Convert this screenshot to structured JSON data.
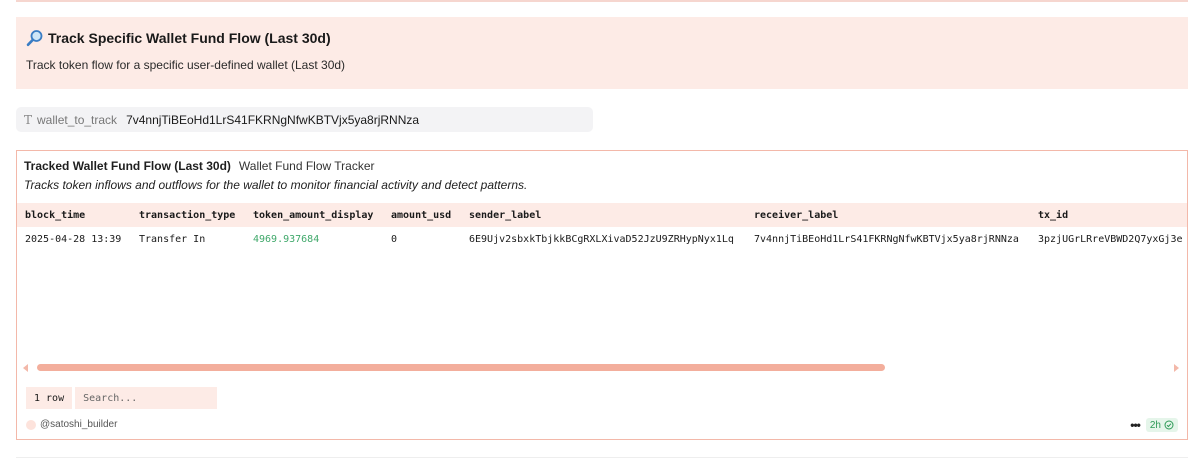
{
  "header": {
    "title": "Track Specific Wallet Fund Flow (Last 30d)",
    "subtitle": "Track token flow for a specific user-defined wallet (Last 30d)"
  },
  "parameter": {
    "name": "wallet_to_track",
    "value": "7v4nnjTiBEoHd1LrS41FKRNgNfwKBTVjx5ya8rjRNNza"
  },
  "panel": {
    "title": "Tracked Wallet Fund Flow (Last 30d)",
    "query_name": "Wallet Fund Flow Tracker",
    "description": "Tracks token inflows and outflows for the wallet to monitor financial activity and detect patterns."
  },
  "table": {
    "columns": [
      "block_time",
      "transaction_type",
      "token_amount_display",
      "amount_usd",
      "sender_label",
      "receiver_label",
      "tx_id"
    ],
    "rows": [
      [
        "2025-04-28 13:39",
        "Transfer In",
        "4969.937684",
        "0",
        "6E9Ujv2sbxkTbjkkBCgRXLXivaD52JzU9ZRHypNyx1Lq",
        "7v4nnjTiBEoHd1LrS41FKRNgNfwKBTVjx5ya8rjRNNza",
        "3pzjUGrLRreVBWD2Q7yxGj3e"
      ]
    ]
  },
  "footer": {
    "row_count": "1 row",
    "search_placeholder": "Search...",
    "author": "@satoshi_builder",
    "age": "2h"
  },
  "colors": {
    "accent_bg": "#fdebe6",
    "accent_border": "#f3b8a9",
    "scroll_thumb": "#f3ae9c",
    "positive": "#3fa86a"
  }
}
